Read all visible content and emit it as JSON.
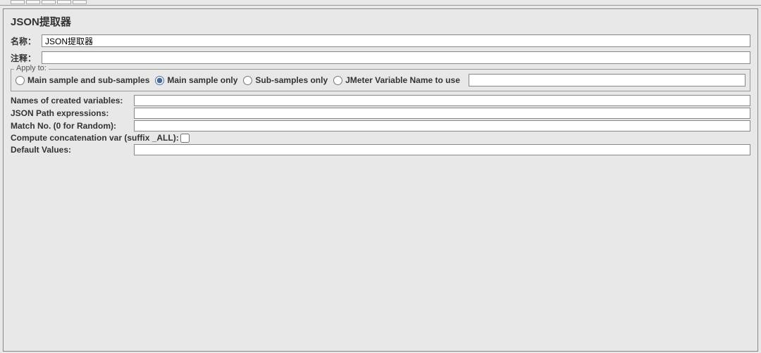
{
  "panel": {
    "title": "JSON提取器"
  },
  "form": {
    "name_label": "名称：",
    "name_value": "JSON提取器",
    "comment_label": "注释：",
    "comment_value": ""
  },
  "apply": {
    "legend": "Apply to:",
    "options": [
      {
        "label": "Main sample and sub-samples",
        "checked": false
      },
      {
        "label": "Main sample only",
        "checked": true
      },
      {
        "label": "Sub-samples only",
        "checked": false
      },
      {
        "label": "JMeter Variable Name to use",
        "checked": false
      }
    ],
    "var_value": ""
  },
  "fields": {
    "names_label": "Names of created variables:",
    "names_value": "",
    "json_path_label": "JSON Path expressions:",
    "json_path_value": "",
    "match_no_label": "Match No. (0 for Random):",
    "match_no_value": "",
    "concat_label": "Compute concatenation var (suffix _ALL):",
    "concat_checked": false,
    "default_label": "Default Values:",
    "default_value": ""
  }
}
